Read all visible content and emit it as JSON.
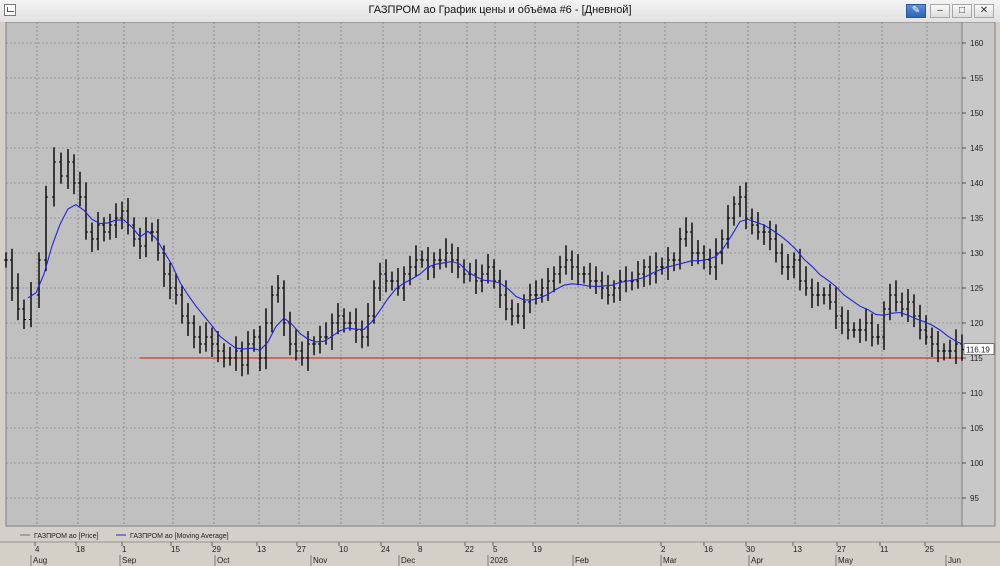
{
  "window": {
    "title": "ГАЗПРОМ ао График цены и объёма #6 - [Дневной]"
  },
  "colors": {
    "plot_bg": "#c0c0c0",
    "candle": "#000000",
    "moving_average": "#2323d8",
    "support_line": "#e03020",
    "grid": "#6e6e6e"
  },
  "legend": [
    {
      "label": "ГАЗПРОМ ао [Price]",
      "color": "#707070"
    },
    {
      "label": "ГАЗПРОМ ао [Moving Average]",
      "color": "#2323d8"
    }
  ],
  "chart_data": {
    "type": "line",
    "ylim": [
      91,
      163
    ],
    "y_ticks": [
      95,
      100,
      105,
      110,
      115,
      120,
      125,
      130,
      135,
      140,
      145,
      150,
      155,
      160
    ],
    "current_price_label": "116.19",
    "support_level": 115,
    "x_day_labels": [
      "4",
      "18",
      "1",
      "15",
      "29",
      "13",
      "27",
      "10",
      "24",
      "8",
      "22",
      "5",
      "19",
      "2",
      "16",
      "30",
      "13",
      "27",
      "11",
      "25"
    ],
    "x_month_labels": [
      "Aug",
      "Sep",
      "Oct",
      "Nov",
      "Dec",
      "2026",
      "Feb",
      "Mar",
      "Apr",
      "May",
      "Jun"
    ],
    "series": [
      {
        "name": "ГАЗПРОМ ао [Price]",
        "style": "ohlc-bars",
        "points": [
          [
            0,
            129
          ],
          [
            6,
            125
          ],
          [
            12,
            122
          ],
          [
            18,
            120.5
          ],
          [
            25,
            124
          ],
          [
            33,
            129
          ],
          [
            40,
            138
          ],
          [
            48,
            143
          ],
          [
            55,
            141
          ],
          [
            62,
            143
          ],
          [
            68,
            140
          ],
          [
            74,
            138
          ],
          [
            80,
            133
          ],
          [
            86,
            132
          ],
          [
            92,
            134
          ],
          [
            98,
            133
          ],
          [
            104,
            134
          ],
          [
            110,
            135
          ],
          [
            116,
            136
          ],
          [
            122,
            134
          ],
          [
            128,
            132
          ],
          [
            134,
            131
          ],
          [
            140,
            133
          ],
          [
            146,
            133
          ],
          [
            152,
            130
          ],
          [
            158,
            127
          ],
          [
            164,
            125
          ],
          [
            170,
            124
          ],
          [
            176,
            121
          ],
          [
            182,
            120
          ],
          [
            188,
            118
          ],
          [
            194,
            117
          ],
          [
            200,
            118
          ],
          [
            206,
            117
          ],
          [
            212,
            116
          ],
          [
            218,
            115
          ],
          [
            224,
            115
          ],
          [
            230,
            116
          ],
          [
            236,
            114
          ],
          [
            242,
            117
          ],
          [
            248,
            118
          ],
          [
            254,
            115
          ],
          [
            260,
            120
          ],
          [
            266,
            124
          ],
          [
            272,
            125
          ],
          [
            278,
            120
          ],
          [
            284,
            117
          ],
          [
            290,
            116
          ],
          [
            296,
            115
          ],
          [
            302,
            117
          ],
          [
            308,
            117
          ],
          [
            314,
            118
          ],
          [
            320,
            118
          ],
          [
            326,
            120
          ],
          [
            332,
            121
          ],
          [
            338,
            120
          ],
          [
            344,
            120
          ],
          [
            350,
            119
          ],
          [
            356,
            118
          ],
          [
            362,
            121
          ],
          [
            368,
            125
          ],
          [
            374,
            127
          ],
          [
            380,
            126
          ],
          [
            386,
            126
          ],
          [
            392,
            125
          ],
          [
            398,
            127
          ],
          [
            404,
            128
          ],
          [
            410,
            129
          ],
          [
            416,
            129
          ],
          [
            422,
            128
          ],
          [
            428,
            129
          ],
          [
            434,
            129
          ],
          [
            440,
            130
          ],
          [
            446,
            129
          ],
          [
            452,
            128
          ],
          [
            458,
            127
          ],
          [
            464,
            127
          ],
          [
            470,
            126
          ],
          [
            476,
            127
          ],
          [
            482,
            128
          ],
          [
            488,
            126
          ],
          [
            494,
            124
          ],
          [
            500,
            122
          ],
          [
            506,
            121
          ],
          [
            512,
            121
          ],
          [
            518,
            123
          ],
          [
            524,
            124
          ],
          [
            530,
            124
          ],
          [
            536,
            125
          ],
          [
            542,
            126
          ],
          [
            548,
            127
          ],
          [
            554,
            128
          ],
          [
            560,
            129
          ],
          [
            566,
            128
          ],
          [
            572,
            127
          ],
          [
            578,
            127
          ],
          [
            584,
            126
          ],
          [
            590,
            126
          ],
          [
            596,
            125
          ],
          [
            602,
            124
          ],
          [
            608,
            125
          ],
          [
            614,
            126
          ],
          [
            620,
            126
          ],
          [
            626,
            126
          ],
          [
            632,
            127
          ],
          [
            638,
            128
          ],
          [
            644,
            127
          ],
          [
            650,
            128
          ],
          [
            656,
            128
          ],
          [
            662,
            129
          ],
          [
            668,
            129
          ],
          [
            674,
            132
          ],
          [
            680,
            133
          ],
          [
            686,
            130
          ],
          [
            692,
            130
          ],
          [
            698,
            129
          ],
          [
            704,
            128
          ],
          [
            710,
            130
          ],
          [
            716,
            132
          ],
          [
            722,
            135
          ],
          [
            728,
            137
          ],
          [
            734,
            138
          ],
          [
            740,
            135
          ],
          [
            746,
            134
          ],
          [
            752,
            133
          ],
          [
            758,
            133
          ],
          [
            764,
            132
          ],
          [
            770,
            130
          ],
          [
            776,
            128
          ],
          [
            782,
            128
          ],
          [
            788,
            129
          ],
          [
            794,
            126
          ],
          [
            800,
            125
          ],
          [
            806,
            124
          ],
          [
            812,
            124
          ],
          [
            818,
            124
          ],
          [
            824,
            123
          ],
          [
            830,
            121
          ],
          [
            836,
            120
          ],
          [
            842,
            119
          ],
          [
            848,
            119
          ],
          [
            854,
            119
          ],
          [
            860,
            120
          ],
          [
            866,
            118
          ],
          [
            872,
            118
          ],
          [
            878,
            122
          ],
          [
            884,
            124
          ],
          [
            890,
            123
          ],
          [
            896,
            122
          ],
          [
            902,
            123
          ],
          [
            908,
            121
          ],
          [
            914,
            119
          ],
          [
            920,
            118
          ],
          [
            926,
            117
          ],
          [
            932,
            116
          ],
          [
            938,
            116
          ],
          [
            944,
            116
          ],
          [
            950,
            117
          ],
          [
            956,
            116.2
          ]
        ]
      },
      {
        "name": "ГАЗПРОМ ао [Moving Average]",
        "style": "line",
        "points": [
          [
            22,
            123.6
          ],
          [
            30,
            124.3
          ],
          [
            38,
            127
          ],
          [
            46,
            131
          ],
          [
            54,
            134.1
          ],
          [
            62,
            136.3
          ],
          [
            70,
            136.9
          ],
          [
            78,
            136.1
          ],
          [
            86,
            134.8
          ],
          [
            94,
            134.2
          ],
          [
            102,
            134.3
          ],
          [
            110,
            134.7
          ],
          [
            118,
            134.7
          ],
          [
            126,
            133.7
          ],
          [
            134,
            132.3
          ],
          [
            142,
            133.1
          ],
          [
            150,
            132.1
          ],
          [
            158,
            130.2
          ],
          [
            166,
            128.3
          ],
          [
            174,
            125.8
          ],
          [
            182,
            124
          ],
          [
            190,
            122.4
          ],
          [
            198,
            121
          ],
          [
            206,
            119.6
          ],
          [
            214,
            118.1
          ],
          [
            222,
            117.2
          ],
          [
            230,
            116.4
          ],
          [
            238,
            116.3
          ],
          [
            246,
            116.4
          ],
          [
            254,
            116.1
          ],
          [
            262,
            117.3
          ],
          [
            270,
            119.5
          ],
          [
            278,
            120.7
          ],
          [
            286,
            119.8
          ],
          [
            294,
            118.5
          ],
          [
            302,
            117.7
          ],
          [
            310,
            117.3
          ],
          [
            318,
            117.4
          ],
          [
            326,
            118.1
          ],
          [
            334,
            118.9
          ],
          [
            342,
            119.3
          ],
          [
            350,
            119.1
          ],
          [
            358,
            119.1
          ],
          [
            366,
            120.2
          ],
          [
            374,
            121.8
          ],
          [
            382,
            123.5
          ],
          [
            390,
            124.9
          ],
          [
            398,
            125.7
          ],
          [
            406,
            126.3
          ],
          [
            414,
            127
          ],
          [
            422,
            128
          ],
          [
            430,
            128.4
          ],
          [
            438,
            128.6
          ],
          [
            446,
            128.8
          ],
          [
            454,
            128.4
          ],
          [
            462,
            127.3
          ],
          [
            470,
            126.6
          ],
          [
            478,
            126.1
          ],
          [
            486,
            126
          ],
          [
            494,
            125.7
          ],
          [
            502,
            124.9
          ],
          [
            510,
            123.8
          ],
          [
            518,
            123.3
          ],
          [
            526,
            123.3
          ],
          [
            534,
            123.6
          ],
          [
            542,
            124.1
          ],
          [
            550,
            124.8
          ],
          [
            558,
            125.4
          ],
          [
            566,
            125.6
          ],
          [
            574,
            125.5
          ],
          [
            582,
            125.3
          ],
          [
            590,
            125.2
          ],
          [
            598,
            125.3
          ],
          [
            606,
            125.4
          ],
          [
            614,
            125.8
          ],
          [
            622,
            126
          ],
          [
            630,
            126.2
          ],
          [
            638,
            126.5
          ],
          [
            646,
            127.1
          ],
          [
            654,
            127.6
          ],
          [
            662,
            128
          ],
          [
            670,
            128.3
          ],
          [
            678,
            128.6
          ],
          [
            686,
            128.9
          ],
          [
            694,
            128.9
          ],
          [
            702,
            129.1
          ],
          [
            710,
            129.5
          ],
          [
            718,
            130.8
          ],
          [
            726,
            132.6
          ],
          [
            734,
            134.5
          ],
          [
            742,
            134.8
          ],
          [
            750,
            134.4
          ],
          [
            758,
            134
          ],
          [
            766,
            133.3
          ],
          [
            774,
            132.5
          ],
          [
            782,
            131.6
          ],
          [
            790,
            130.5
          ],
          [
            798,
            129.1
          ],
          [
            806,
            128.1
          ],
          [
            814,
            126.9
          ],
          [
            822,
            126.1
          ],
          [
            830,
            125.2
          ],
          [
            838,
            124
          ],
          [
            846,
            123.2
          ],
          [
            854,
            122.4
          ],
          [
            862,
            121.9
          ],
          [
            870,
            121.2
          ],
          [
            878,
            121.1
          ],
          [
            886,
            121.4
          ],
          [
            894,
            121.5
          ],
          [
            902,
            121.1
          ],
          [
            910,
            120.6
          ],
          [
            918,
            120.2
          ],
          [
            926,
            119.7
          ],
          [
            934,
            119
          ],
          [
            942,
            118.1
          ],
          [
            950,
            117.4
          ],
          [
            956,
            117
          ]
        ]
      }
    ]
  }
}
